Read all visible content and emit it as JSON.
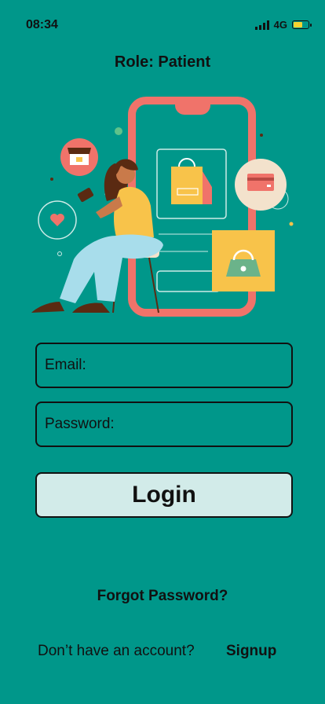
{
  "status_bar": {
    "time": "08:34",
    "network": "4G",
    "battery_level": 0.6,
    "battery_color": "#F5D230"
  },
  "header": {
    "role_title": "Role: Patient"
  },
  "hero_illustration": {
    "icon": "shopping-phone-illustration",
    "colors": {
      "phone": "#F0736A",
      "shirt": "#F8C34A",
      "pants": "#A8DDEB",
      "hair": "#5A2A12",
      "bag_card": "#F8C34A"
    }
  },
  "form": {
    "email_placeholder": "Email:",
    "email_value": "",
    "password_placeholder": "Password:",
    "password_value": "",
    "login_label": "Login"
  },
  "links": {
    "forgot_password": "Forgot Password?",
    "signup_prompt": "Don’t have an account?",
    "signup": "Signup"
  },
  "colors": {
    "background": "#00978A",
    "button_fill": "#D2EBE9",
    "border": "#111111"
  }
}
